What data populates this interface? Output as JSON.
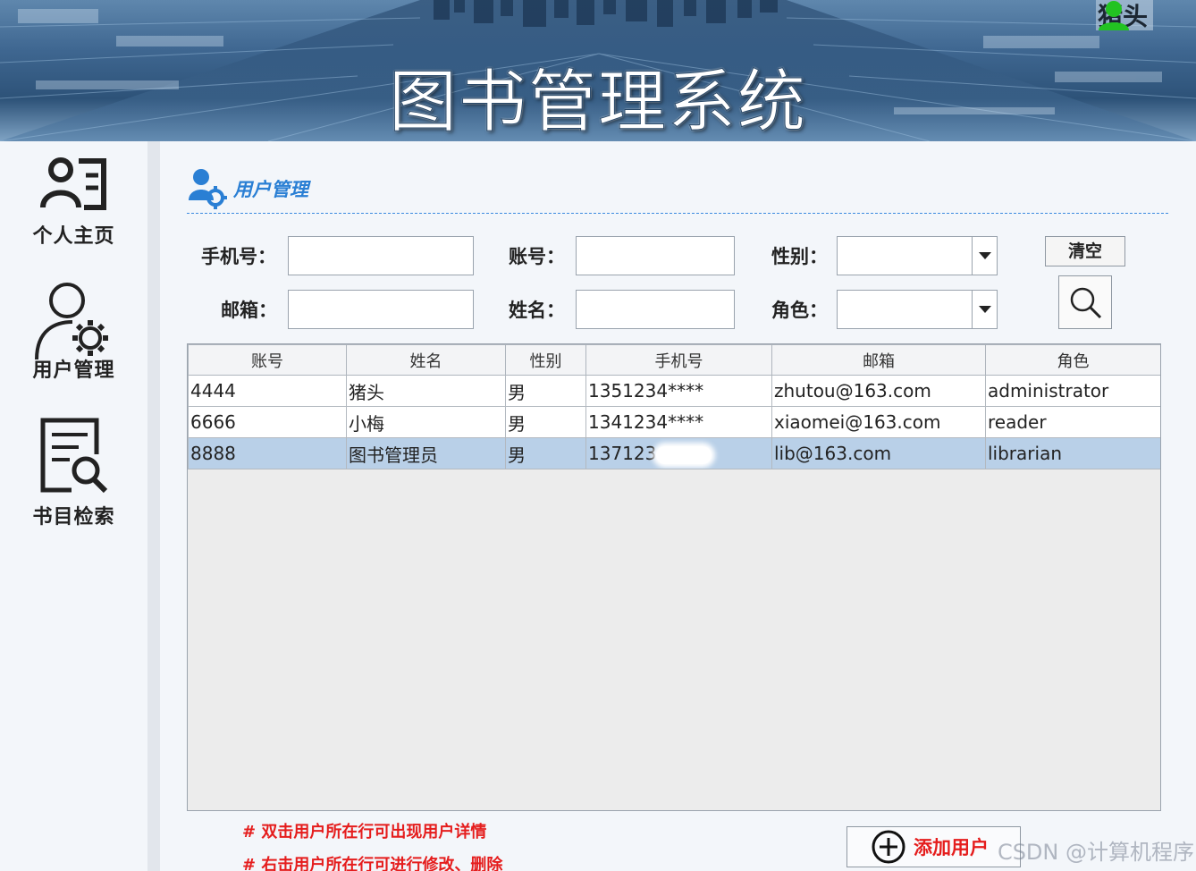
{
  "app": {
    "title": "图书管理系统",
    "user_name": "猪头"
  },
  "sidebar": {
    "items": [
      {
        "label": "个人主页",
        "icon": "profile-card-icon"
      },
      {
        "label": "用户管理",
        "icon": "user-gear-icon"
      },
      {
        "label": "书目检索",
        "icon": "document-search-icon"
      }
    ]
  },
  "section": {
    "title": "用户管理",
    "icon": "users-gear-icon"
  },
  "filters": {
    "phone_label": "手机号：",
    "phone_value": "",
    "account_label": "账号：",
    "account_value": "",
    "gender_label": "性别：",
    "gender_value": "",
    "email_label": "邮箱：",
    "email_value": "",
    "name_label": "姓名：",
    "name_value": "",
    "role_label": "角色：",
    "role_value": "",
    "clear_label": "清空",
    "search_icon": "search-icon"
  },
  "table": {
    "columns": [
      "账号",
      "姓名",
      "性别",
      "手机号",
      "邮箱",
      "角色"
    ],
    "rows": [
      {
        "account": "4444",
        "name": "猪头",
        "gender": "男",
        "phone": "1351234****",
        "email": "zhutou@163.com",
        "role": "administrator"
      },
      {
        "account": "6666",
        "name": "小梅",
        "gender": "男",
        "phone": "1341234****",
        "email": "xiaomei@163.com",
        "role": "reader"
      },
      {
        "account": "8888",
        "name": "图书管理员",
        "gender": "男",
        "phone": "137123",
        "email": "lib@163.com",
        "role": "librarian"
      }
    ],
    "selected_row": 2
  },
  "notes": {
    "note1": "# 双击用户所在行可出现用户详情",
    "note2": "# 右击用户所在行可进行修改、删除"
  },
  "add_button": {
    "label": "添加用户",
    "icon": "plus-circle-icon"
  },
  "watermark": "CSDN @计算机程序",
  "colors": {
    "accent_blue": "#2a7fd4",
    "note_red": "#e51d1d",
    "selected_row": "#b9d0e8",
    "user_icon_green": "#22c322"
  }
}
